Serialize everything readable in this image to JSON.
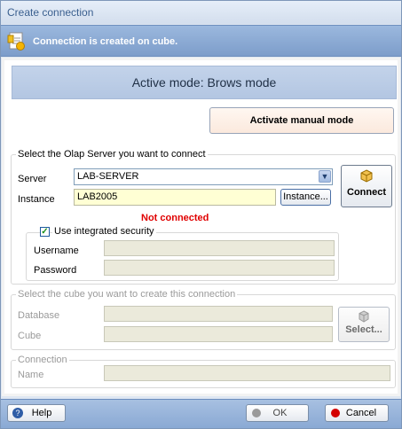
{
  "window": {
    "title": "Create connection"
  },
  "banner": {
    "text": "Connection is created on cube."
  },
  "mode": {
    "header": "Active mode: Brows mode",
    "manual_button": "Activate manual mode"
  },
  "server_group": {
    "legend": "Select the Olap Server you want to connect",
    "server_label": "Server",
    "server_value": "LAB-SERVER",
    "instance_label": "Instance",
    "instance_value": "LAB2005",
    "instance_button": "Instance...",
    "connect_button": "Connect",
    "status": "Not connected",
    "integrated_security_label": "Use integrated security",
    "integrated_security_checked": true,
    "username_label": "Username",
    "username_value": "",
    "password_label": "Password",
    "password_value": ""
  },
  "cube_group": {
    "legend": "Select the cube you want to create this connection",
    "database_label": "Database",
    "database_value": "",
    "cube_label": "Cube",
    "cube_value": "",
    "select_button": "Select..."
  },
  "connection_group": {
    "legend": "Connection",
    "name_label": "Name",
    "name_value": ""
  },
  "footer": {
    "help": "Help",
    "ok": "OK",
    "cancel": "Cancel"
  },
  "colors": {
    "status_error": "#e00000",
    "accent_blue": "#7d9dca"
  }
}
